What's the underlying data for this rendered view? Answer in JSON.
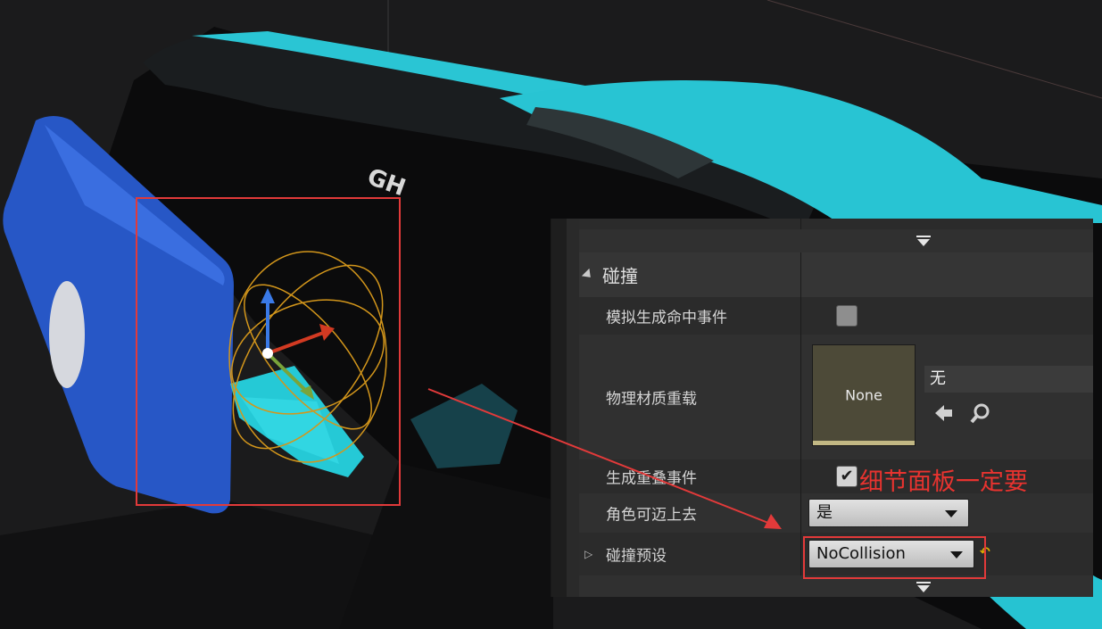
{
  "details_panel": {
    "category": {
      "label": "碰撞"
    },
    "rows": {
      "simulation_generates_hit_events": {
        "label": "模拟生成命中事件",
        "checked": false
      },
      "phys_material_override": {
        "label": "物理材质重载",
        "thumbnail_label": "None",
        "asset_value": "无",
        "browse_icon": "arrow-left-icon",
        "find_icon": "search-icon"
      },
      "generate_overlap_events": {
        "label": "生成重叠事件",
        "checked": true,
        "check_glyph": "✔"
      },
      "can_character_step_up_on": {
        "label": "角色可迈上去",
        "value": "是"
      },
      "collision_presets": {
        "label": "碰撞预设",
        "value": "NoCollision",
        "expand_glyph": "▷",
        "reset_glyph": "↶"
      }
    }
  },
  "annotation": {
    "text": "细节面板一定要",
    "color": "#e8332f"
  },
  "colors": {
    "accent_cyan": "#28c6d6",
    "gizmo_blue": "#2a62d8",
    "gizmo_red": "#d23a22",
    "gizmo_green": "#7aa43a",
    "gizmo_yellow": "#d79b1e"
  }
}
